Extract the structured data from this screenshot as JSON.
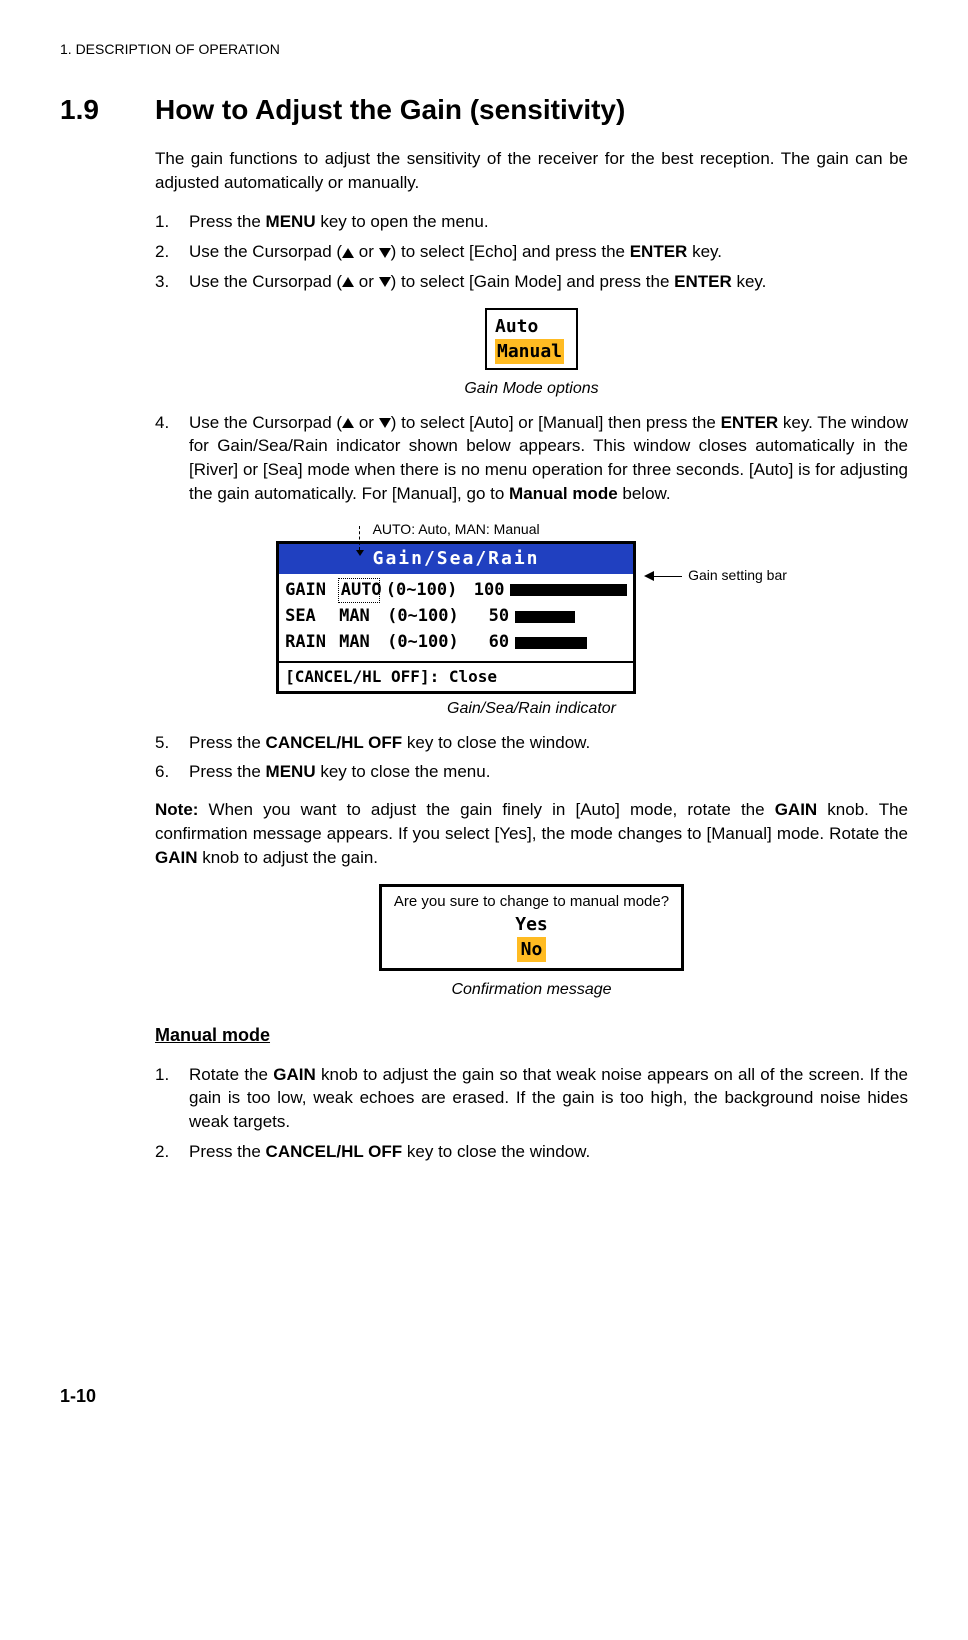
{
  "header": "1.  DESCRIPTION OF OPERATION",
  "section": {
    "number": "1.9",
    "title": "How to Adjust the Gain (sensitivity)"
  },
  "intro": "The gain functions to adjust the sensitivity of the receiver for the best reception. The gain can be adjusted automatically or manually.",
  "steps1": {
    "s1_a": "Press the ",
    "s1_b": "MENU",
    "s1_c": " key to open the menu.",
    "s2_a": "Use the Cursorpad (",
    "s2_b": " or ",
    "s2_c": ") to select [Echo] and press the ",
    "s2_d": "ENTER",
    "s2_e": " key.",
    "s3_a": "Use the Cursorpad (",
    "s3_b": " or ",
    "s3_c": ") to select [Gain Mode] and press the ",
    "s3_d": "ENTER",
    "s3_e": " key."
  },
  "modebox": {
    "auto": "Auto",
    "manual": "Manual"
  },
  "caption1": "Gain Mode options",
  "step4": {
    "a": "Use the Cursorpad (",
    "b": " or ",
    "c": ") to select [Auto] or [Manual] then press the ",
    "d": "ENTER",
    "e": " key. The window for Gain/Sea/Rain indicator shown below appears. This window closes automatically in the [River] or [Sea] mode when there is no menu operation for three seconds. [Auto] is for adjusting the gain automatically. For [Manual], go to ",
    "f": "Manual mode",
    "g": " below."
  },
  "anno_top": "AUTO: Auto, MAN: Manual",
  "anno_side": "Gain setting bar",
  "indicator": {
    "title": "Gain/Sea/Rain",
    "rows": [
      {
        "label": "GAIN",
        "mode": "AUTO",
        "range": "(0~100)",
        "value": "100"
      },
      {
        "label": "SEA",
        "mode": "MAN",
        "range": "(0~100)",
        "value": "50"
      },
      {
        "label": "RAIN",
        "mode": "MAN",
        "range": "(0~100)",
        "value": "60"
      }
    ],
    "footer": "[CANCEL/HL OFF]: Close"
  },
  "caption2": "Gain/Sea/Rain indicator",
  "steps2": {
    "s5_a": "Press the ",
    "s5_b": "CANCEL/HL OFF",
    "s5_c": " key to close the window.",
    "s6_a": "Press the ",
    "s6_b": "MENU",
    "s6_c": " key to close the menu."
  },
  "note": {
    "a": "Note:",
    "b": " When you want to adjust the gain finely in [Auto] mode, rotate the ",
    "c": "GAIN",
    "d": " knob. The confirmation message appears. If you select [Yes], the mode changes to [Manual] mode. Rotate the ",
    "e": "GAIN",
    "f": " knob to adjust the gain."
  },
  "confirm": {
    "msg": "Are you sure to change to manual mode?",
    "yes": "Yes",
    "no": "No"
  },
  "caption3": "Confirmation message",
  "subsection": "Manual mode",
  "manual": {
    "s1_a": "Rotate the ",
    "s1_b": "GAIN",
    "s1_c": " knob to adjust the gain so that weak noise appears on all of the screen. If the gain is too low, weak echoes are erased. If the gain is too high, the background noise hides weak targets.",
    "s2_a": "Press the ",
    "s2_b": "CANCEL/HL OFF",
    "s2_c": " key to close the window."
  },
  "page_number": "1-10",
  "chart_data": {
    "type": "bar",
    "title": "Gain/Sea/Rain",
    "categories": [
      "GAIN",
      "SEA",
      "RAIN"
    ],
    "values": [
      100,
      50,
      60
    ],
    "xlabel": "",
    "ylabel": "",
    "ylim": [
      0,
      100
    ]
  }
}
